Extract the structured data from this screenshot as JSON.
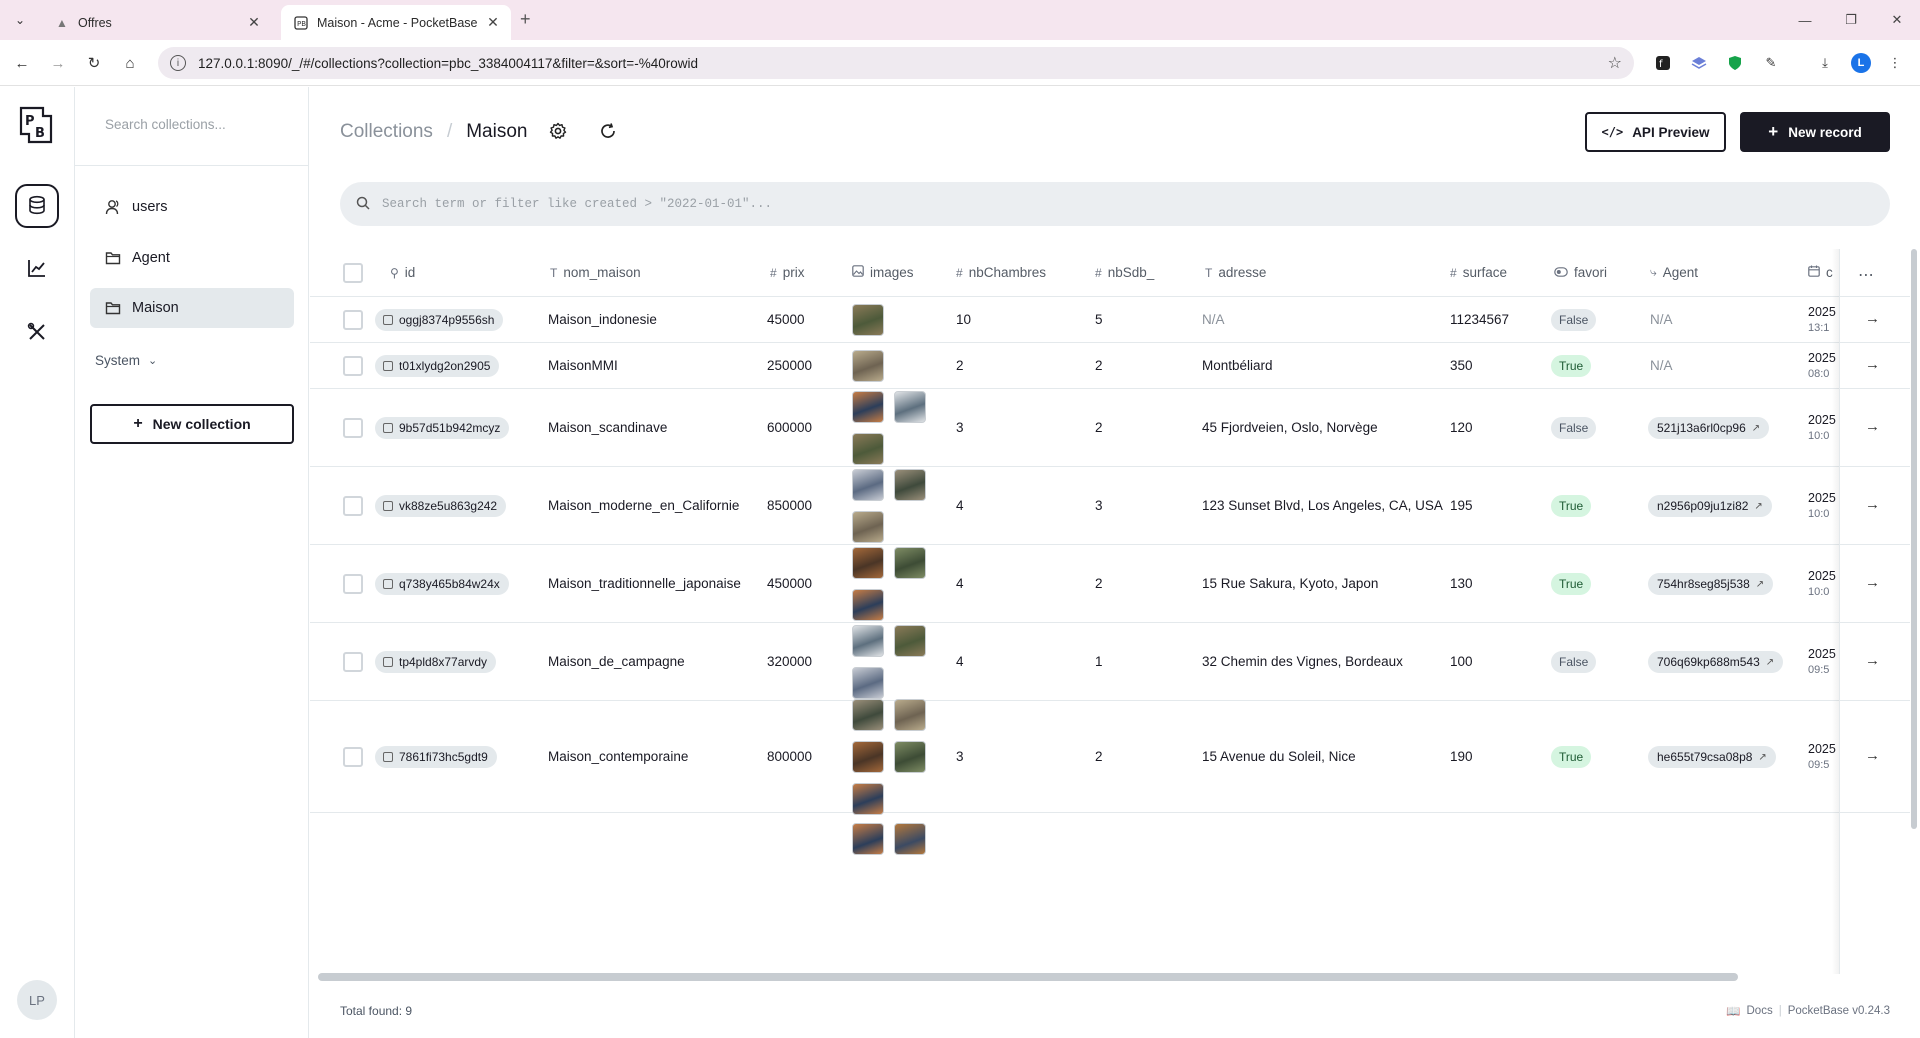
{
  "browser": {
    "tabs": [
      {
        "title": "Offres",
        "active": false
      },
      {
        "title": "Maison - Acme - PocketBase",
        "active": true
      }
    ],
    "url": "127.0.0.1:8090/_/#/collections?collection=pbc_3384004117&filter=&sort=-%40rowid",
    "profile_initial": "L"
  },
  "sidebar": {
    "search_placeholder": "Search collections...",
    "collections": [
      {
        "label": "users",
        "icon": "user-icon"
      },
      {
        "label": "Agent",
        "icon": "folder-icon"
      },
      {
        "label": "Maison",
        "icon": "folder-icon",
        "active": true
      }
    ],
    "system_label": "System",
    "new_collection_label": "New collection",
    "avatar_initials": "LP"
  },
  "header": {
    "breadcrumb_parent": "Collections",
    "breadcrumb_sep": "/",
    "breadcrumb_current": "Maison",
    "api_preview_label": "API Preview",
    "new_record_label": "New record"
  },
  "search": {
    "placeholder": "Search term or filter like created > \"2022-01-01\"..."
  },
  "table": {
    "columns": [
      {
        "key": "id",
        "label": "id",
        "icon": "key"
      },
      {
        "key": "nom_maison",
        "label": "nom_maison",
        "icon": "T"
      },
      {
        "key": "prix",
        "label": "prix",
        "icon": "#"
      },
      {
        "key": "images",
        "label": "images",
        "icon": "image"
      },
      {
        "key": "nbChambres",
        "label": "nbChambres",
        "icon": "#"
      },
      {
        "key": "nbSdb_",
        "label": "nbSdb_",
        "icon": "#"
      },
      {
        "key": "adresse",
        "label": "adresse",
        "icon": "T"
      },
      {
        "key": "surface",
        "label": "surface",
        "icon": "#"
      },
      {
        "key": "favori",
        "label": "favori",
        "icon": "toggle"
      },
      {
        "key": "Agent",
        "label": "Agent",
        "icon": "relation"
      },
      {
        "key": "created",
        "label": "c",
        "icon": "calendar"
      }
    ],
    "rows": [
      {
        "id": "oggj8374p9556sh",
        "nom_maison": "Maison_indonesie",
        "prix": "45000",
        "images": 1,
        "nbChambres": "10",
        "nbSdb": "5",
        "adresse": "N/A",
        "surface": "11234567",
        "favori": "False",
        "agent": "N/A",
        "created_year": "2025",
        "created_time": "13:1"
      },
      {
        "id": "t01xlydg2on2905",
        "nom_maison": "MaisonMMI",
        "prix": "250000",
        "images": 1,
        "nbChambres": "2",
        "nbSdb": "2",
        "adresse": "Montbéliard",
        "surface": "350",
        "favori": "True",
        "agent": "N/A",
        "created_year": "2025",
        "created_time": "08:0"
      },
      {
        "id": "9b57d51b942mcyz",
        "nom_maison": "Maison_scandinave",
        "prix": "600000",
        "images": 3,
        "nbChambres": "3",
        "nbSdb": "2",
        "adresse": "45 Fjordveien, Oslo, Norvège",
        "surface": "120",
        "favori": "False",
        "agent": "521j13a6rl0cp96",
        "created_year": "2025",
        "created_time": "10:0"
      },
      {
        "id": "vk88ze5u863g242",
        "nom_maison": "Maison_moderne_en_Californie",
        "prix": "850000",
        "images": 3,
        "nbChambres": "4",
        "nbSdb": "3",
        "adresse": "123 Sunset Blvd, Los Angeles, CA, USA",
        "surface": "195",
        "favori": "True",
        "agent": "n2956p09ju1zi82",
        "created_year": "2025",
        "created_time": "10:0"
      },
      {
        "id": "q738y465b84w24x",
        "nom_maison": "Maison_traditionnelle_japonaise",
        "prix": "450000",
        "images": 3,
        "nbChambres": "4",
        "nbSdb": "2",
        "adresse": "15 Rue Sakura, Kyoto, Japon",
        "surface": "130",
        "favori": "True",
        "agent": "754hr8seg85j538",
        "created_year": "2025",
        "created_time": "10:0"
      },
      {
        "id": "tp4pld8x77arvdy",
        "nom_maison": "Maison_de_campagne",
        "prix": "320000",
        "images": 3,
        "nbChambres": "4",
        "nbSdb": "1",
        "adresse": "32 Chemin des Vignes, Bordeaux",
        "surface": "100",
        "favori": "False",
        "agent": "706q69kp688m543",
        "created_year": "2025",
        "created_time": "09:5"
      },
      {
        "id": "7861fi73hc5gdt9",
        "nom_maison": "Maison_contemporaine",
        "prix": "800000",
        "images": 5,
        "nbChambres": "3",
        "nbSdb": "2",
        "adresse": "15 Avenue du Soleil, Nice",
        "surface": "190",
        "favori": "True",
        "agent": "he655t79csa08p8",
        "created_year": "2025",
        "created_time": "09:5"
      }
    ]
  },
  "footer": {
    "total_found": "Total found: 9",
    "docs_label": "Docs",
    "separator": "|",
    "version": "PocketBase v0.24.3"
  }
}
